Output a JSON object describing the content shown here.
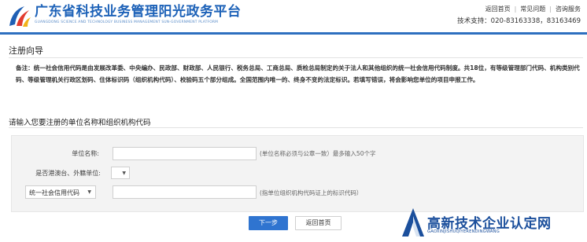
{
  "header": {
    "brand_title": "广东省科技业务管理阳光政务平台",
    "brand_subtitle": "GUANGDONG SCIENCE AND TECHNOLOGY BUSINESS MANAGEMENT SUN-GOVERNMENT PLATFORM",
    "links": [
      "返回首页",
      "常见问题",
      "咨询服务"
    ],
    "support": "技术支持：020-83163338，83163469"
  },
  "page": {
    "title": "注册向导",
    "note": "备注：统一社会信用代码是由发展改革委、中央编办、民政部、财政部、人民银行、税务总局、工商总局、质检总局制定的关于法人和其他组织的统一社会信用代码制度。共18位，有等级管理部门代码、机构类别代码、等级管理机关行政区划码、住体标识码（组织机构代码）、校验码五个部分组成。全国范围内唯一的、终身不变的法定标识。若填写错误，将会影响您单位的项目申报工作。",
    "section_title": "请输入您要注册的单位名称和组织机构代码"
  },
  "form": {
    "unit_name_label": "单位名称:",
    "unit_name_value": "",
    "unit_name_hint": "(单位名称必须与公章一致）最多输入50个字",
    "hk_label": "是否港澳台、外籍单位:",
    "hk_value": "",
    "code_type": "统一社会信用代码",
    "code_value": "",
    "code_hint": "(指单位组织机构代码证上的标识代码）"
  },
  "buttons": {
    "next": "下一步",
    "home": "返回首页"
  },
  "watermark": {
    "title": "高新技术企业认定网",
    "subtitle": "GAOXINJISHUQIYERENDINGWANG"
  },
  "colors": {
    "brand": "#1d62b8",
    "primary_button": "#2f74d0",
    "form_bg": "#f3f3f3"
  }
}
